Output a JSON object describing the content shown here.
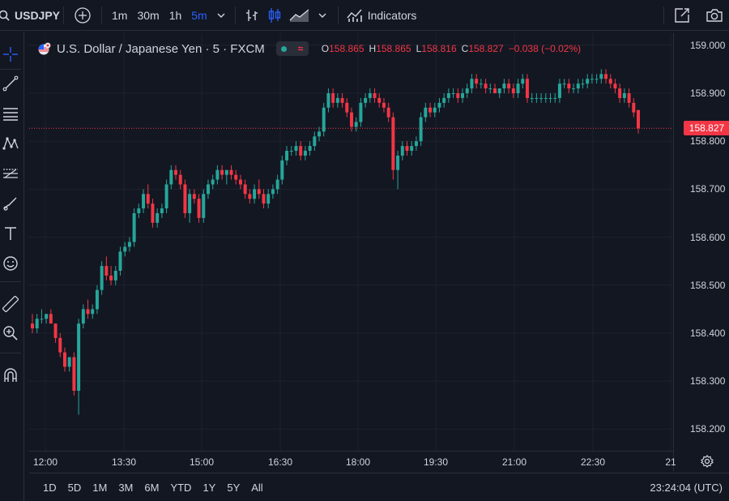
{
  "toolbar": {
    "symbol": "USDJPY",
    "intervals": [
      {
        "label": "1m",
        "active": false
      },
      {
        "label": "30m",
        "active": false
      },
      {
        "label": "1h",
        "active": false
      },
      {
        "label": "5m",
        "active": true
      }
    ],
    "indicators_label": "Indicators",
    "icons": [
      "search-icon",
      "add-symbol-icon",
      "chevron-down-icon",
      "bar-style-icon",
      "candles-icon",
      "area-icon",
      "chevron-down-icon",
      "indicators-icon",
      "fullscreen-icon",
      "camera-icon"
    ]
  },
  "legend": {
    "title": "U.S. Dollar / Japanese Yen · 5 · FXCM",
    "open_label": "O",
    "open": "158.865",
    "high_label": "H",
    "high": "158.865",
    "low_label": "L",
    "low": "158.816",
    "close_label": "C",
    "close": "158.827",
    "change": "−0.038 (−0.02%)"
  },
  "colors": {
    "up": "#26a69a",
    "down": "#f23645",
    "background": "#131722",
    "grid": "#1e222d",
    "active": "#2962ff"
  },
  "left_tools": [
    "crosshair-icon",
    "trend-line-icon",
    "horizontal-lines-icon",
    "pattern-icon",
    "fib-icon",
    "brush-icon",
    "text-icon",
    "emoji-icon",
    "ruler-icon",
    "zoom-icon",
    "magnet-icon"
  ],
  "chart_data": {
    "type": "candlestick",
    "price_labels": [
      "159.000",
      "158.900",
      "158.800",
      "158.700",
      "158.600",
      "158.500",
      "158.400",
      "158.300",
      "158.200"
    ],
    "time_labels": [
      "12:00",
      "13:30",
      "15:00",
      "16:30",
      "18:00",
      "19:30",
      "21:00",
      "22:30",
      "21"
    ],
    "last_price": "158.827",
    "ylim": [
      158.155,
      159.025
    ],
    "candles": [
      [
        158.42,
        158.44,
        158.4,
        158.41
      ],
      [
        158.41,
        158.44,
        158.4,
        158.43
      ],
      [
        158.43,
        158.45,
        158.42,
        158.43
      ],
      [
        158.43,
        158.44,
        158.42,
        158.44
      ],
      [
        158.44,
        158.45,
        158.42,
        158.42
      ],
      [
        158.42,
        158.42,
        158.38,
        158.39
      ],
      [
        158.39,
        158.4,
        158.35,
        158.36
      ],
      [
        158.36,
        158.37,
        158.32,
        158.33
      ],
      [
        158.33,
        158.35,
        158.32,
        158.35
      ],
      [
        158.35,
        158.36,
        158.27,
        158.28
      ],
      [
        158.28,
        158.43,
        158.23,
        158.42
      ],
      [
        158.42,
        158.46,
        158.41,
        158.45
      ],
      [
        158.45,
        158.47,
        158.43,
        158.44
      ],
      [
        158.44,
        158.46,
        158.43,
        158.45
      ],
      [
        158.45,
        158.5,
        158.44,
        158.49
      ],
      [
        158.49,
        158.55,
        158.48,
        158.54
      ],
      [
        158.54,
        158.56,
        158.51,
        158.52
      ],
      [
        158.52,
        158.54,
        158.5,
        158.51
      ],
      [
        158.51,
        158.54,
        158.5,
        158.53
      ],
      [
        158.53,
        158.58,
        158.52,
        158.57
      ],
      [
        158.57,
        158.59,
        158.56,
        158.58
      ],
      [
        158.58,
        158.6,
        158.57,
        158.59
      ],
      [
        158.59,
        158.66,
        158.58,
        158.65
      ],
      [
        158.65,
        158.67,
        158.64,
        158.66
      ],
      [
        158.66,
        158.7,
        158.65,
        158.69
      ],
      [
        158.69,
        158.71,
        158.66,
        158.67
      ],
      [
        158.67,
        158.68,
        158.62,
        158.63
      ],
      [
        158.63,
        158.66,
        158.62,
        158.65
      ],
      [
        158.65,
        158.67,
        158.64,
        158.66
      ],
      [
        158.66,
        158.72,
        158.65,
        158.71
      ],
      [
        158.71,
        158.75,
        158.7,
        158.74
      ],
      [
        158.74,
        158.75,
        158.72,
        158.73
      ],
      [
        158.73,
        158.74,
        158.7,
        158.71
      ],
      [
        158.71,
        158.72,
        158.64,
        158.65
      ],
      [
        158.65,
        158.7,
        158.63,
        158.69
      ],
      [
        158.69,
        158.7,
        158.67,
        158.68
      ],
      [
        158.68,
        158.69,
        158.63,
        158.64
      ],
      [
        158.64,
        158.7,
        158.63,
        158.69
      ],
      [
        158.69,
        158.72,
        158.68,
        158.71
      ],
      [
        158.71,
        158.73,
        158.7,
        158.72
      ],
      [
        158.72,
        158.75,
        158.71,
        158.74
      ],
      [
        158.74,
        158.75,
        158.72,
        158.73
      ],
      [
        158.73,
        158.74,
        158.71,
        158.74
      ],
      [
        158.74,
        158.75,
        158.72,
        158.73
      ],
      [
        158.73,
        158.74,
        158.71,
        158.72
      ],
      [
        158.72,
        158.73,
        158.7,
        158.71
      ],
      [
        158.71,
        158.72,
        158.68,
        158.69
      ],
      [
        158.69,
        158.7,
        158.67,
        158.68
      ],
      [
        158.68,
        158.71,
        158.67,
        158.7
      ],
      [
        158.7,
        158.72,
        158.68,
        158.69
      ],
      [
        158.69,
        158.7,
        158.66,
        158.67
      ],
      [
        158.67,
        158.7,
        158.66,
        158.69
      ],
      [
        158.69,
        158.71,
        158.68,
        158.7
      ],
      [
        158.7,
        158.73,
        158.69,
        158.72
      ],
      [
        158.72,
        158.77,
        158.71,
        158.76
      ],
      [
        158.76,
        158.79,
        158.75,
        158.78
      ],
      [
        158.78,
        158.79,
        158.77,
        158.78
      ],
      [
        158.78,
        158.8,
        158.77,
        158.79
      ],
      [
        158.79,
        158.8,
        158.76,
        158.77
      ],
      [
        158.77,
        158.79,
        158.76,
        158.78
      ],
      [
        158.78,
        158.8,
        158.77,
        158.79
      ],
      [
        158.79,
        158.82,
        158.78,
        158.81
      ],
      [
        158.81,
        158.83,
        158.8,
        158.82
      ],
      [
        158.82,
        158.88,
        158.81,
        158.87
      ],
      [
        158.87,
        158.91,
        158.86,
        158.9
      ],
      [
        158.9,
        158.91,
        158.87,
        158.88
      ],
      [
        158.88,
        158.9,
        158.87,
        158.89
      ],
      [
        158.89,
        158.9,
        158.87,
        158.88
      ],
      [
        158.88,
        158.89,
        158.85,
        158.86
      ],
      [
        158.86,
        158.87,
        158.82,
        158.83
      ],
      [
        158.83,
        158.85,
        158.82,
        158.84
      ],
      [
        158.84,
        158.89,
        158.83,
        158.88
      ],
      [
        158.88,
        158.9,
        158.87,
        158.89
      ],
      [
        158.89,
        158.91,
        158.88,
        158.9
      ],
      [
        158.9,
        158.91,
        158.88,
        158.89
      ],
      [
        158.89,
        158.9,
        158.87,
        158.88
      ],
      [
        158.88,
        158.89,
        158.86,
        158.87
      ],
      [
        158.87,
        158.88,
        158.84,
        158.85
      ],
      [
        158.85,
        158.86,
        158.72,
        158.74
      ],
      [
        158.74,
        158.78,
        158.7,
        158.77
      ],
      [
        158.77,
        158.8,
        158.76,
        158.79
      ],
      [
        158.79,
        158.8,
        158.77,
        158.78
      ],
      [
        158.78,
        158.8,
        158.77,
        158.79
      ],
      [
        158.79,
        158.81,
        158.78,
        158.8
      ],
      [
        158.8,
        158.86,
        158.79,
        158.85
      ],
      [
        158.85,
        158.88,
        158.84,
        158.87
      ],
      [
        158.87,
        158.88,
        158.85,
        158.86
      ],
      [
        158.86,
        158.88,
        158.85,
        158.87
      ],
      [
        158.87,
        158.89,
        158.86,
        158.88
      ],
      [
        158.88,
        158.9,
        158.87,
        158.89
      ],
      [
        158.89,
        158.91,
        158.88,
        158.9
      ],
      [
        158.9,
        158.91,
        158.89,
        158.9
      ],
      [
        158.9,
        158.91,
        158.88,
        158.89
      ],
      [
        158.89,
        158.91,
        158.88,
        158.9
      ],
      [
        158.9,
        158.92,
        158.89,
        158.91
      ],
      [
        158.91,
        158.94,
        158.9,
        158.93
      ],
      [
        158.93,
        158.94,
        158.91,
        158.92
      ],
      [
        158.92,
        158.93,
        158.91,
        158.92
      ],
      [
        158.92,
        158.93,
        158.9,
        158.91
      ],
      [
        158.91,
        158.92,
        158.9,
        158.91
      ],
      [
        158.91,
        158.92,
        158.9,
        158.9
      ],
      [
        158.9,
        158.91,
        158.89,
        158.91
      ],
      [
        158.91,
        158.93,
        158.9,
        158.92
      ],
      [
        158.92,
        158.93,
        158.9,
        158.91
      ],
      [
        158.91,
        158.92,
        158.89,
        158.9
      ],
      [
        158.9,
        158.93,
        158.89,
        158.92
      ],
      [
        158.92,
        158.94,
        158.91,
        158.93
      ],
      [
        158.93,
        158.94,
        158.88,
        158.89
      ],
      [
        158.89,
        158.9,
        158.88,
        158.89
      ],
      [
        158.89,
        158.9,
        158.88,
        158.89
      ],
      [
        158.89,
        158.9,
        158.88,
        158.89
      ],
      [
        158.89,
        158.9,
        158.88,
        158.89
      ],
      [
        158.89,
        158.9,
        158.88,
        158.89
      ],
      [
        158.89,
        158.9,
        158.88,
        158.89
      ],
      [
        158.89,
        158.93,
        158.88,
        158.92
      ],
      [
        158.92,
        158.93,
        158.91,
        158.92
      ],
      [
        158.92,
        158.93,
        158.9,
        158.91
      ],
      [
        158.91,
        158.92,
        158.9,
        158.91
      ],
      [
        158.91,
        158.93,
        158.9,
        158.92
      ],
      [
        158.92,
        158.93,
        158.91,
        158.92
      ],
      [
        158.92,
        158.94,
        158.91,
        158.93
      ],
      [
        158.93,
        158.94,
        158.92,
        158.93
      ],
      [
        158.93,
        158.94,
        158.92,
        158.93
      ],
      [
        158.93,
        158.95,
        158.92,
        158.94
      ],
      [
        158.94,
        158.95,
        158.92,
        158.93
      ],
      [
        158.93,
        158.94,
        158.91,
        158.92
      ],
      [
        158.92,
        158.93,
        158.9,
        158.91
      ],
      [
        158.91,
        158.92,
        158.88,
        158.89
      ],
      [
        158.89,
        158.91,
        158.88,
        158.9
      ],
      [
        158.9,
        158.91,
        158.87,
        158.88
      ],
      [
        158.88,
        158.89,
        158.85,
        158.86
      ],
      [
        158.865,
        158.865,
        158.816,
        158.827
      ]
    ]
  },
  "range_buttons": [
    "1D",
    "5D",
    "1M",
    "3M",
    "6M",
    "YTD",
    "1Y",
    "5Y",
    "All"
  ],
  "clock": "23:24:04 (UTC)"
}
